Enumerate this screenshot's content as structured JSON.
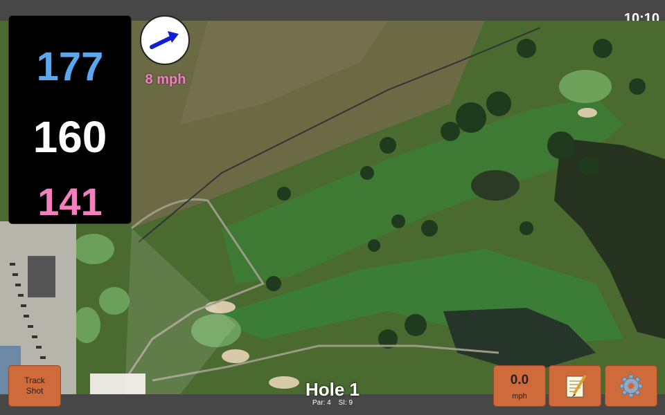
{
  "status_bar": {
    "time": "10:10"
  },
  "yardage": {
    "back": "177",
    "middle": "160",
    "front": "141"
  },
  "wind": {
    "speed": "8 mph",
    "direction_icon": "arrow-right-icon"
  },
  "buttons": {
    "track_shot": "Track\nShot",
    "speed_value": "0.0",
    "speed_unit": "mph",
    "notes_icon": "notepad-icon",
    "settings_icon": "gear-icon"
  },
  "hole": {
    "title": "Hole 1",
    "par": "Par: 4",
    "si": "SI: 9"
  },
  "colors": {
    "back": "#5aa7ee",
    "middle": "#ffffff",
    "front": "#f47fbd",
    "button": "#cf6b3a"
  }
}
